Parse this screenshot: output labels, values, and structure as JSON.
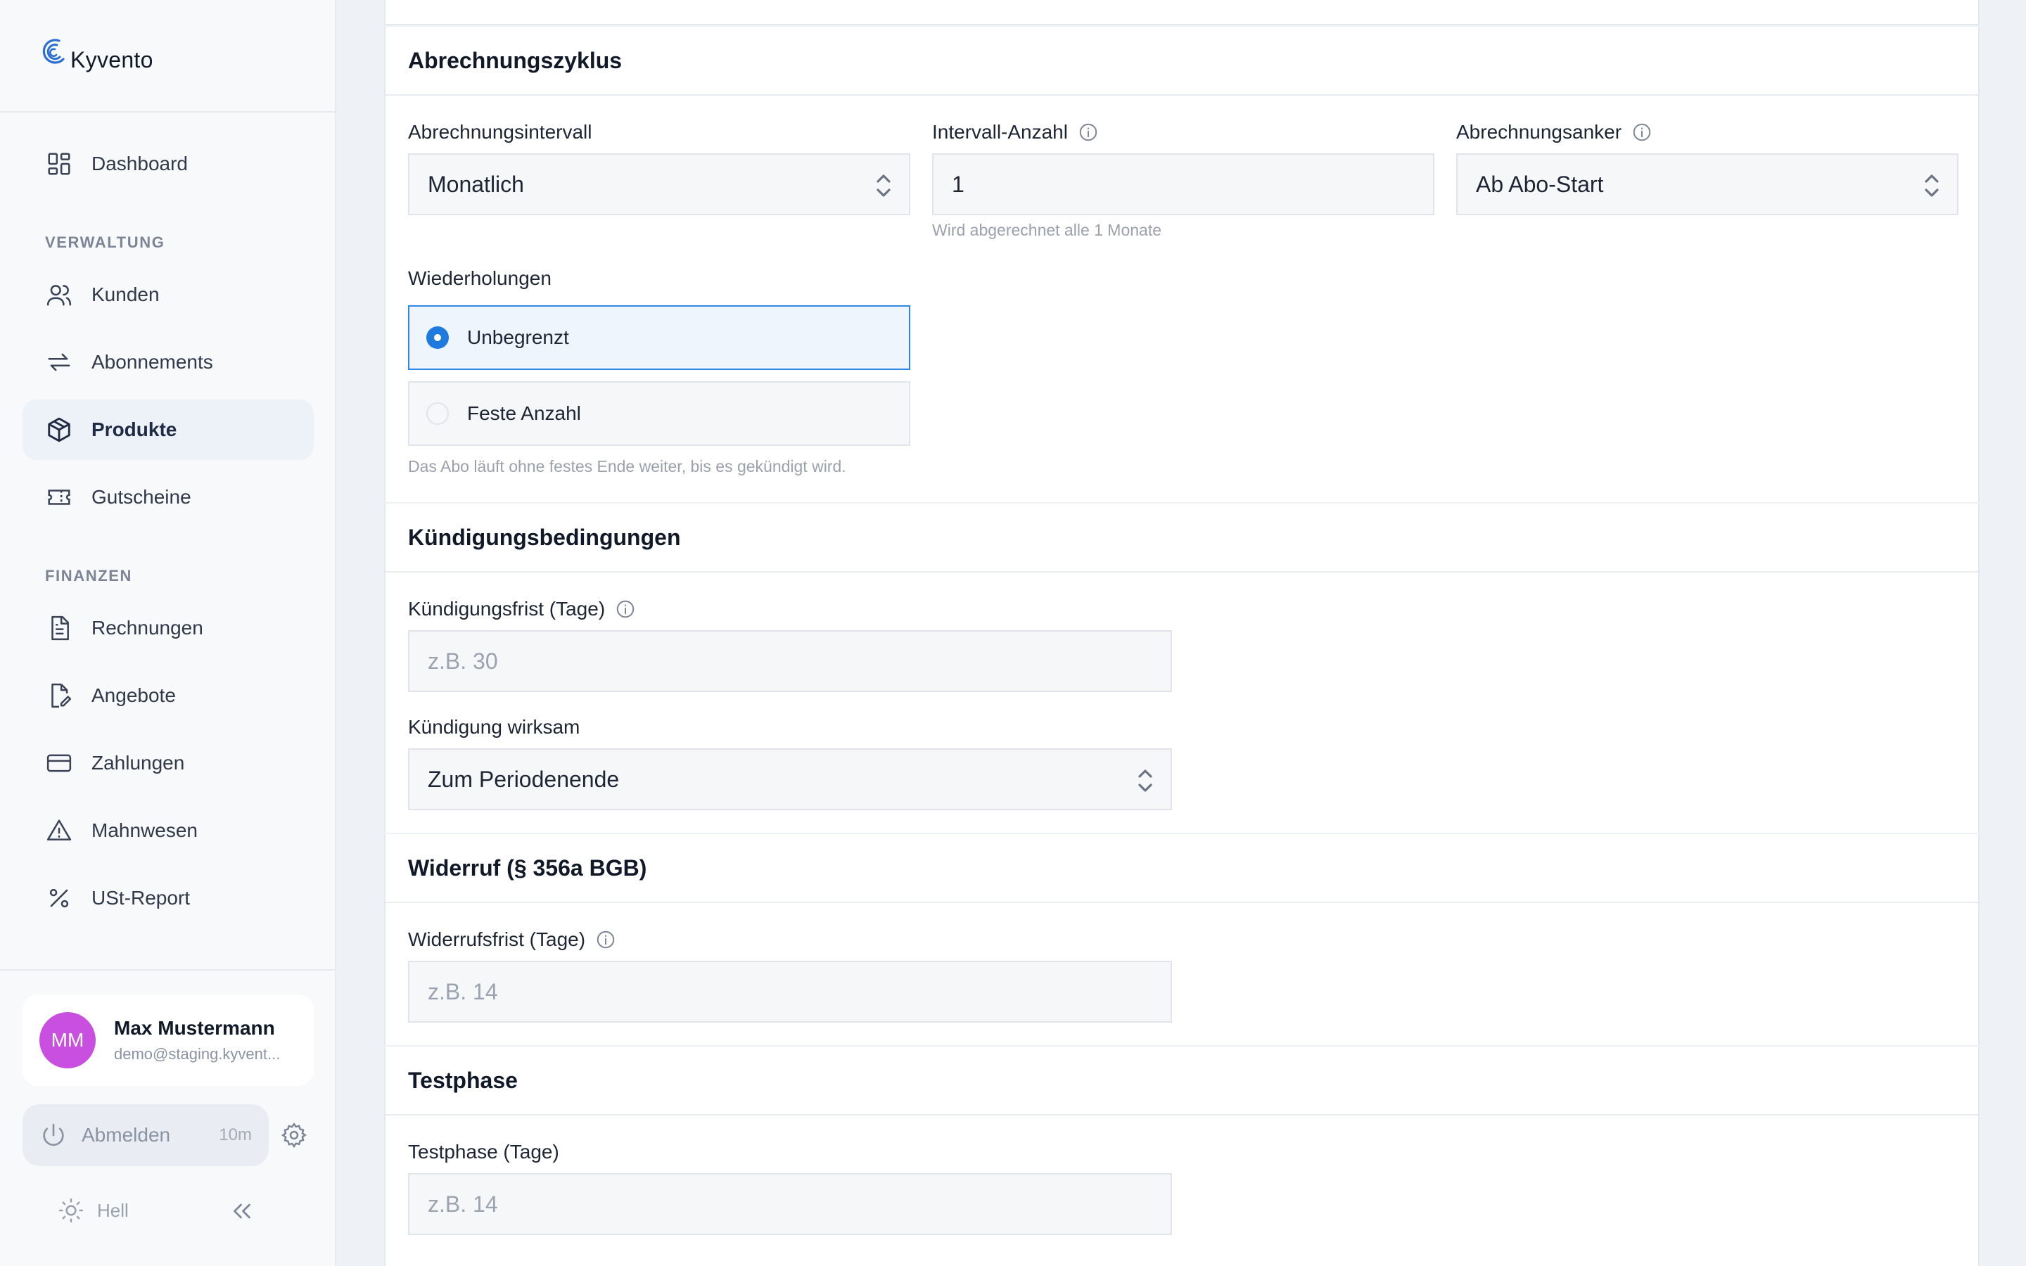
{
  "brand": {
    "name": "Kyvento"
  },
  "sidebar": {
    "dashboard": "Dashboard",
    "section_verwaltung": "VERWALTUNG",
    "section_finanzen": "FINANZEN",
    "items": [
      {
        "label": "Kunden"
      },
      {
        "label": "Abonnements"
      },
      {
        "label": "Produkte",
        "active": true
      },
      {
        "label": "Gutscheine"
      },
      {
        "label": "Rechnungen"
      },
      {
        "label": "Angebote"
      },
      {
        "label": "Zahlungen"
      },
      {
        "label": "Mahnwesen"
      },
      {
        "label": "USt-Report"
      }
    ],
    "user": {
      "initials": "MM",
      "name": "Max Mustermann",
      "email": "demo@staging.kyvent..."
    },
    "logout": {
      "label": "Abmelden",
      "timer": "10m"
    },
    "theme": {
      "label": "Hell"
    }
  },
  "billing": {
    "title": "Abrechnungszyklus",
    "interval": {
      "label": "Abrechnungsintervall",
      "value": "Monatlich"
    },
    "count": {
      "label": "Intervall-Anzahl",
      "value": "1",
      "hint": "Wird abgerechnet alle 1 Monate"
    },
    "anchor": {
      "label": "Abrechnungsanker",
      "value": "Ab Abo-Start"
    },
    "repeats": {
      "label": "Wiederholungen",
      "options": [
        "Unbegrenzt",
        "Feste Anzahl"
      ],
      "selected": "Unbegrenzt",
      "hint": "Das Abo läuft ohne festes Ende weiter, bis es gekündigt wird."
    }
  },
  "cancellation": {
    "title": "Kündigungsbedingungen",
    "notice": {
      "label": "Kündigungsfrist (Tage)",
      "placeholder": "z.B. 30"
    },
    "effective": {
      "label": "Kündigung wirksam",
      "value": "Zum Periodenende"
    }
  },
  "withdrawal": {
    "title": "Widerruf (§ 356a BGB)",
    "period": {
      "label": "Widerrufsfrist (Tage)",
      "placeholder": "z.B. 14"
    }
  },
  "trial": {
    "title": "Testphase",
    "days": {
      "label": "Testphase (Tage)",
      "placeholder": "z.B. 14"
    }
  },
  "colors": {
    "accent": "#1f7ae0",
    "avatar": "#c94fe0",
    "active_nav_bg": "#edf1f8"
  }
}
